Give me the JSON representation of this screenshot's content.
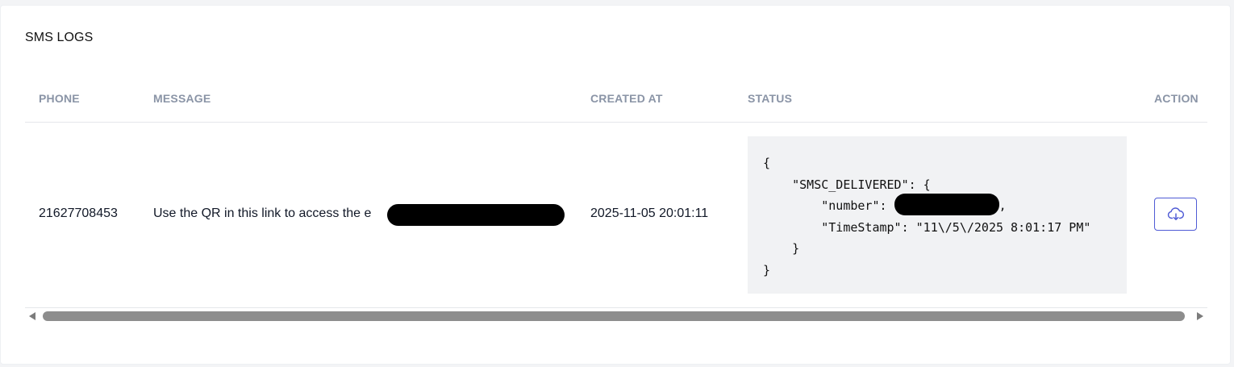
{
  "card": {
    "title": "SMS LOGS"
  },
  "table": {
    "columns": [
      "PHONE",
      "MESSAGE",
      "CREATED AT",
      "STATUS",
      "ACTION"
    ],
    "rows": [
      {
        "phone": "21627708453",
        "message": "Use the QR in this link to access the e",
        "created_at": "2025-11-05 20:01:11",
        "status_lines": {
          "l1": "{",
          "l2_key": "    \"SMSC_DELIVERED\": {",
          "l3_key": "        \"number\": ",
          "l3_tail": ",",
          "l4": "        \"TimeStamp\": \"11\\/5\\/2025 8:01:17 PM\"",
          "l5": "    }",
          "l6": "}"
        },
        "action_icon": "cloud-download-icon"
      }
    ]
  },
  "scrollbar": {
    "thumb_fraction": 1.0
  },
  "colors": {
    "header_text": "#8a94a6",
    "accent": "#4f5bd5",
    "code_bg": "#f1f2f4"
  }
}
